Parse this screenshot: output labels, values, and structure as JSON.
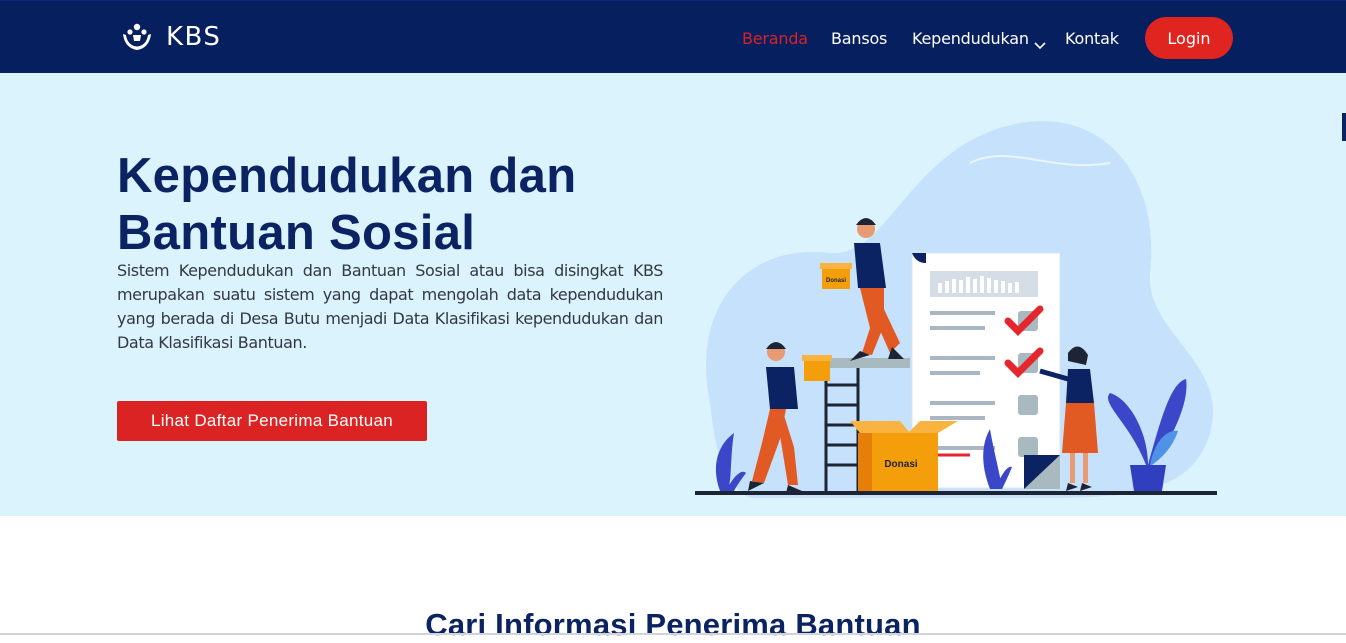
{
  "brand": {
    "name": "KBS",
    "logo_icon": "hands-people-icon"
  },
  "nav": {
    "items": [
      {
        "label": "Beranda",
        "active": true
      },
      {
        "label": "Bansos"
      },
      {
        "label": "Kependudukan",
        "dropdown": true
      },
      {
        "label": "Kontak"
      }
    ],
    "login_label": "Login"
  },
  "hero": {
    "title": "Kependudukan dan Bantuan Sosial",
    "description": "Sistem Kependudukan dan Bantuan Sosial atau bisa disingkat KBS merupakan suatu sistem yang dapat mengolah data kependudukan yang berada di Desa Butu menjadi Data Klasifikasi kependudukan dan Data Klasifikasi Bantuan.",
    "cta_label": "Lihat Daftar Penerima Bantuan",
    "illustration": {
      "box_label_large": "Donasi",
      "box_label_small": "Donasi"
    }
  },
  "section": {
    "title": "Cari Informasi Penerima Bantuan"
  },
  "colors": {
    "navbar": "#061f5e",
    "accent_red": "#e0241f",
    "hero_bg": "#daf3fd",
    "title_navy": "#0b2363"
  }
}
